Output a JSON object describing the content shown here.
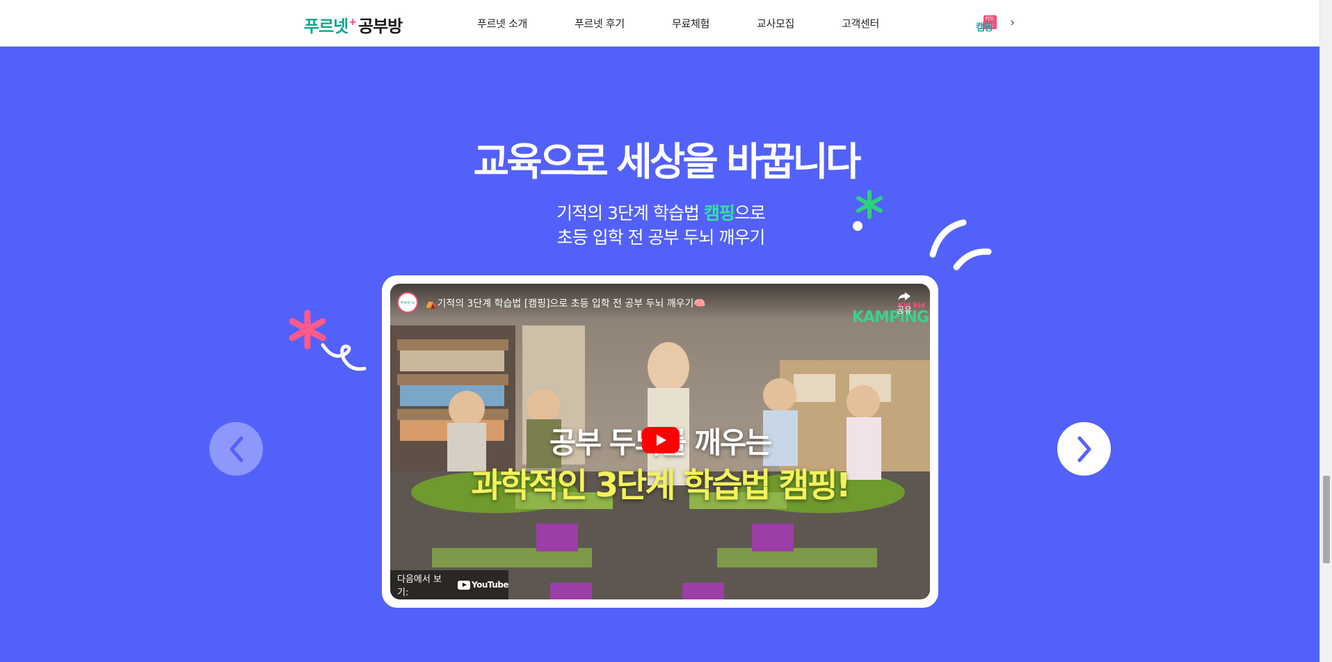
{
  "header": {
    "logo": {
      "part_a": "푸르넷",
      "plus": "+",
      "part_b": "공부방"
    },
    "nav": [
      "푸르넷 소개",
      "푸르넷 후기",
      "무료체험",
      "교사모집",
      "고객센터"
    ],
    "camp_badge": {
      "small": "키드키드",
      "big": "캠핑"
    },
    "chevron_icon": "chevron-right-icon"
  },
  "hero": {
    "headline": "교육으로 세상을 바꿉니다",
    "sub_line1_before": "기적의 3단계 학습법 ",
    "sub_line1_accent": "캠핑",
    "sub_line1_after": "으로",
    "sub_line2": "초등 입학 전 공부 두뇌 깨우기",
    "accent_color": "#35e29a"
  },
  "video": {
    "channel_avatar_text": "푸르넷 tv",
    "title": "⛺기적의 3단계 학습법 [캠핑]으로 초등 입학 전 공부 두뇌 깨우기🧠",
    "share_label": "공유",
    "brand_mark": "KAMPING",
    "brand_kid": "Kid kid",
    "overlay_line1": "공부 두뇌를 깨우는",
    "overlay_line2": "과학적인 3단계 학습법 캠핑!",
    "watch_on_label": "다음에서 보기:",
    "youtube_label": "YouTube"
  },
  "carousel": {
    "prev_icon": "chevron-left-icon",
    "next_icon": "chevron-right-icon"
  },
  "colors": {
    "background": "#5361fb",
    "brand_green": "#10a88a",
    "pink": "#ff5a8a",
    "decor_green": "#2ed178"
  }
}
